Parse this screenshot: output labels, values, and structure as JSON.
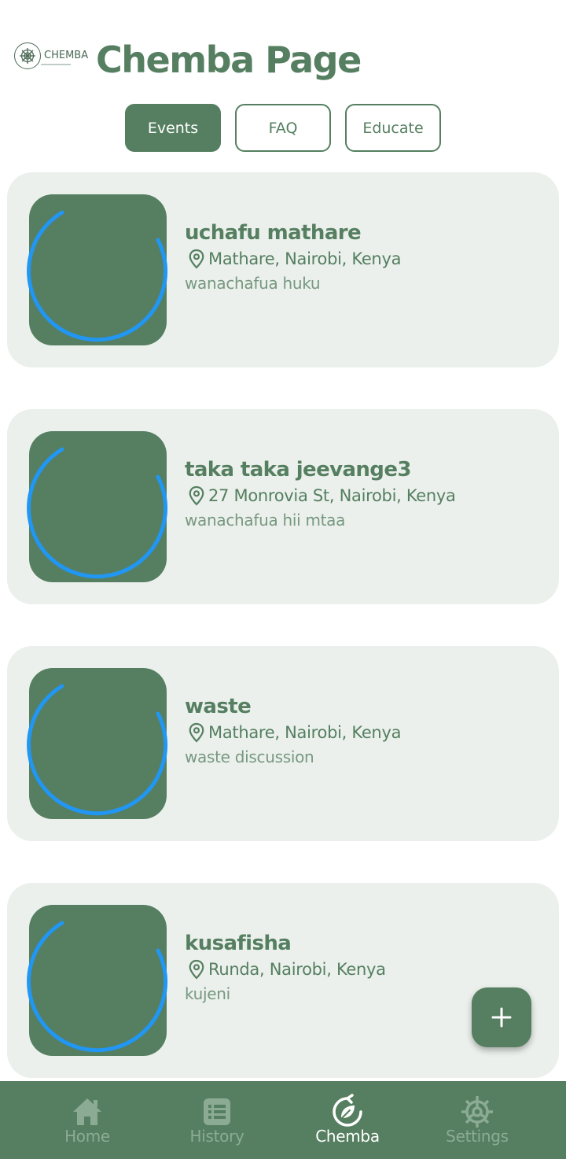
{
  "header": {
    "logo_text": "CHEMBA",
    "title": "Chemba Page"
  },
  "tabs": [
    {
      "label": "Events",
      "active": true
    },
    {
      "label": "FAQ",
      "active": false
    },
    {
      "label": "Educate",
      "active": false
    }
  ],
  "events": [
    {
      "title": "uchafu mathare",
      "location": "Mathare, Nairobi, Kenya",
      "description": "wanachafua huku"
    },
    {
      "title": "taka taka jeevange3",
      "location": "27 Monrovia St, Nairobi, Kenya",
      "description": "wanachafua hii mtaa"
    },
    {
      "title": "waste",
      "location": "Mathare, Nairobi, Kenya",
      "description": "waste discussion"
    },
    {
      "title": "kusafisha",
      "location": "Runda, Nairobi, Kenya",
      "description": "kujeni"
    }
  ],
  "fab": {
    "icon": "plus-icon"
  },
  "bottom_nav": [
    {
      "label": "Home",
      "icon": "home-icon",
      "active": false
    },
    {
      "label": "History",
      "icon": "list-icon",
      "active": false
    },
    {
      "label": "Chemba",
      "icon": "recycle-leaf-icon",
      "active": true
    },
    {
      "label": "Settings",
      "icon": "gear-icon",
      "active": false
    }
  ],
  "colors": {
    "primary": "#557f60",
    "card_bg": "#ebf0ec",
    "spinner": "#2196f3",
    "nav_inactive": "#8cab94"
  }
}
